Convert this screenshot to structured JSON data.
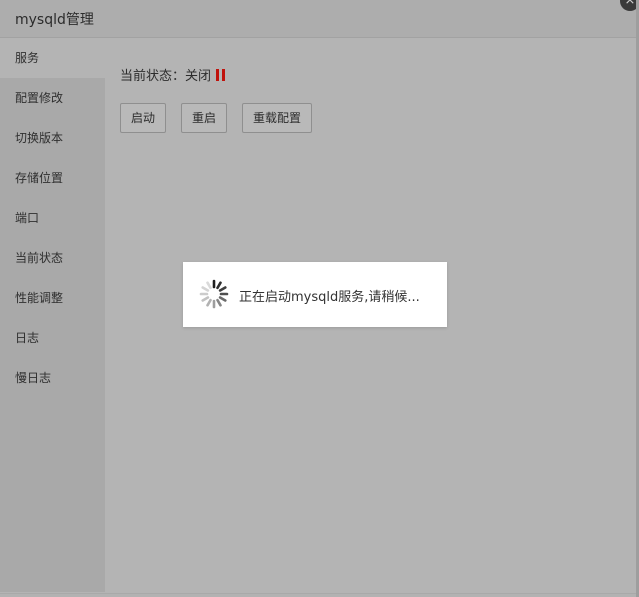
{
  "dialog": {
    "title": "mysqld管理",
    "close_glyph": "×"
  },
  "sidebar": {
    "items": [
      {
        "label": "服务",
        "active": true
      },
      {
        "label": "配置修改"
      },
      {
        "label": "切换版本"
      },
      {
        "label": "存储位置"
      },
      {
        "label": "端口"
      },
      {
        "label": "当前状态"
      },
      {
        "label": "性能调整"
      },
      {
        "label": "日志"
      },
      {
        "label": "慢日志"
      }
    ]
  },
  "service": {
    "status_label": "当前状态：关闭",
    "status_icon": "pause-icon",
    "status_color": "#c0120c",
    "buttons": {
      "start": "启动",
      "restart": "重启",
      "reload": "重载配置"
    }
  },
  "loading": {
    "text": "正在启动mysqld服务,请稍候...",
    "icon": "spinner-icon"
  }
}
